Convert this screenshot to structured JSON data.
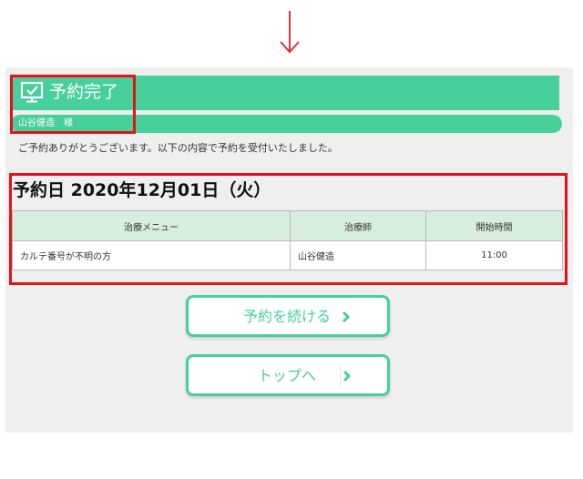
{
  "header": {
    "title": "予約完了",
    "icon": "monitor-check-icon"
  },
  "customer": {
    "name_line": "山谷健造　様"
  },
  "message": "ご予約ありがとうございます。以下の内容で予約を受付いたしました。",
  "reservation": {
    "date_heading": "予約日 2020年12月01日（火）",
    "columns": [
      "治療メニュー",
      "治療師",
      "開始時間"
    ],
    "rows": [
      [
        "カルテ番号が不明の方",
        "山谷健造",
        "11:00"
      ]
    ]
  },
  "buttons": {
    "continue_label": "予約を続ける",
    "top_label": "トップへ"
  },
  "colors": {
    "accent": "#47cf9c",
    "header_row": "#d7eedc",
    "highlight": "#e8101a",
    "panel": "#efefef"
  }
}
